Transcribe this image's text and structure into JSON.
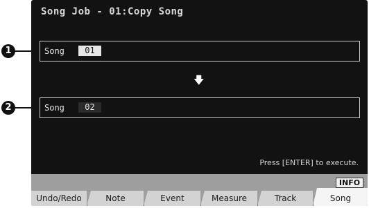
{
  "screen": {
    "title": "Song Job - 01:Copy Song"
  },
  "source": {
    "label": "Song",
    "value": "01"
  },
  "destination": {
    "label": "Song",
    "value": "02"
  },
  "arrow_icon": "down-arrow",
  "status_text": "Press [ENTER] to execute.",
  "info_button": "INFO",
  "tabs": [
    {
      "label": "Undo/Redo"
    },
    {
      "label": "Note"
    },
    {
      "label": "Event"
    },
    {
      "label": "Measure"
    },
    {
      "label": "Track"
    },
    {
      "label": "Song",
      "active": true
    }
  ],
  "callouts": [
    {
      "label": "1"
    },
    {
      "label": "2"
    }
  ]
}
